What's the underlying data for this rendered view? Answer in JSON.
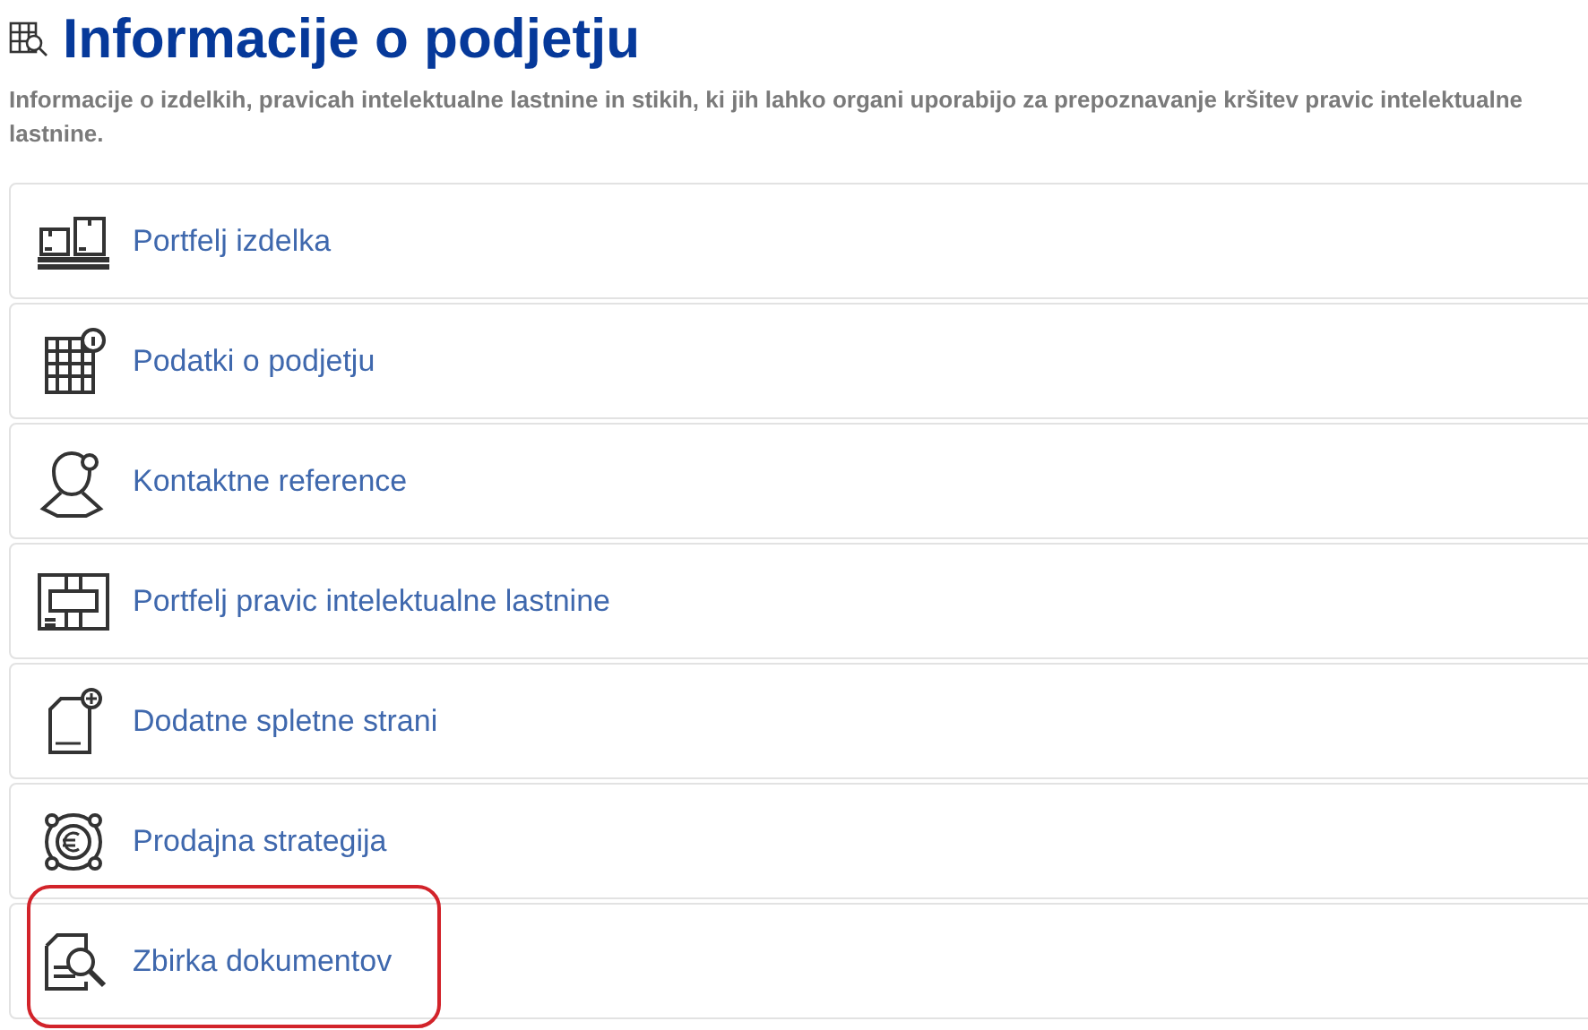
{
  "header": {
    "title": "Informacije o podjetju",
    "description": "Informacije o izdelkih, pravicah intelektualne lastnine in stikih, ki jih lahko organi uporabijo za prepoznavanje kršitev pravic intelektualne lastnine."
  },
  "items": [
    {
      "kind": "pallet",
      "label": "Portfelj izdelka",
      "highlighted": false
    },
    {
      "kind": "building",
      "label": "Podatki o podjetju",
      "highlighted": false
    },
    {
      "kind": "contact",
      "label": "Kontaktne reference",
      "highlighted": false
    },
    {
      "kind": "ipr",
      "label": "Portfelj pravic intelektualne lastnine",
      "highlighted": false
    },
    {
      "kind": "webpage",
      "label": "Dodatne spletne strani",
      "highlighted": false
    },
    {
      "kind": "euro",
      "label": "Prodajna strategija",
      "highlighted": false
    },
    {
      "kind": "document",
      "label": "Zbirka dokumentov",
      "highlighted": true
    }
  ]
}
